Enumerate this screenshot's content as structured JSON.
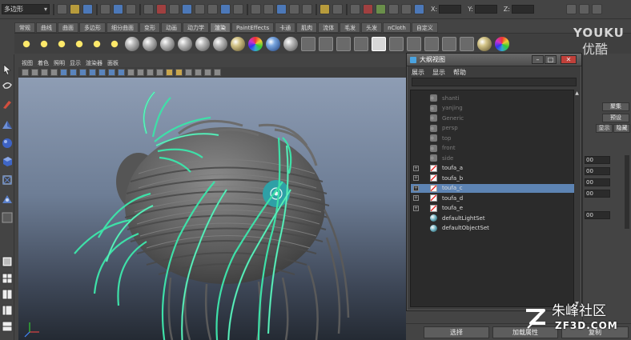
{
  "statusline": {
    "menu_items": [
      "",
      "",
      "",
      "",
      "",
      "",
      "",
      "",
      "",
      "",
      ""
    ],
    "mode_value": "多边形",
    "coord_labels": [
      "X:",
      "Y:",
      "Z:"
    ]
  },
  "shelf_tabs": [
    "常规",
    "曲线",
    "曲面",
    "多边形",
    "细分曲面",
    "变形",
    "动画",
    "动力学",
    "渲染",
    "PaintEffects",
    "卡通",
    "肌肉",
    "流体",
    "毛发",
    "头发",
    "nCloth",
    "自定义"
  ],
  "shelf_active_tab": 8,
  "viewport": {
    "menu": [
      "视图",
      "着色",
      "照明",
      "显示",
      "渲染器",
      "面板"
    ]
  },
  "outliner": {
    "title": "大纲视图",
    "menu": [
      "展示",
      "显示",
      "帮助"
    ],
    "items": [
      {
        "label": "shanti",
        "type": "camera",
        "dim": true,
        "expandable": false
      },
      {
        "label": "yanjing",
        "type": "camera",
        "dim": true,
        "expandable": false
      },
      {
        "label": "Generic",
        "type": "camera",
        "dim": true,
        "expandable": false
      },
      {
        "label": "persp",
        "type": "camera",
        "dim": true,
        "expandable": false
      },
      {
        "label": "top",
        "type": "camera",
        "dim": true,
        "expandable": false
      },
      {
        "label": "front",
        "type": "camera",
        "dim": true,
        "expandable": false
      },
      {
        "label": "side",
        "type": "camera",
        "dim": true,
        "expandable": false
      },
      {
        "label": "toufa_a",
        "type": "mesh",
        "dim": false,
        "expandable": true
      },
      {
        "label": "toufa_b",
        "type": "mesh",
        "dim": false,
        "expandable": true
      },
      {
        "label": "toufa_c",
        "type": "mesh",
        "dim": false,
        "expandable": true,
        "selected": true
      },
      {
        "label": "toufa_d",
        "type": "mesh",
        "dim": false,
        "expandable": true
      },
      {
        "label": "toufa_e",
        "type": "mesh",
        "dim": false,
        "expandable": true
      },
      {
        "label": "defaultLightSet",
        "type": "set",
        "dim": false,
        "expandable": false
      },
      {
        "label": "defaultObjectSet",
        "type": "set",
        "dim": false,
        "expandable": false
      }
    ]
  },
  "attr_panel": {
    "focus_label": "聚集",
    "preset_label": "预设",
    "show_label": "显示",
    "hide_label": "隐藏",
    "field_values": [
      "00",
      "00",
      "00",
      "00",
      "00"
    ]
  },
  "bottom_bar": {
    "select_label": "选择",
    "load_label": "加载属性",
    "copy_label": "复制"
  },
  "watermarks": {
    "youku_en": "YOUKU",
    "youku_cn": "优酷",
    "zf_cn": "朱峰社区",
    "zf_en": "ZF3D.COM"
  },
  "colors": {
    "wire_green": "#3ee0a8",
    "selection_blue": "#5d84b4",
    "hair_gray": "#6f6f6f"
  }
}
